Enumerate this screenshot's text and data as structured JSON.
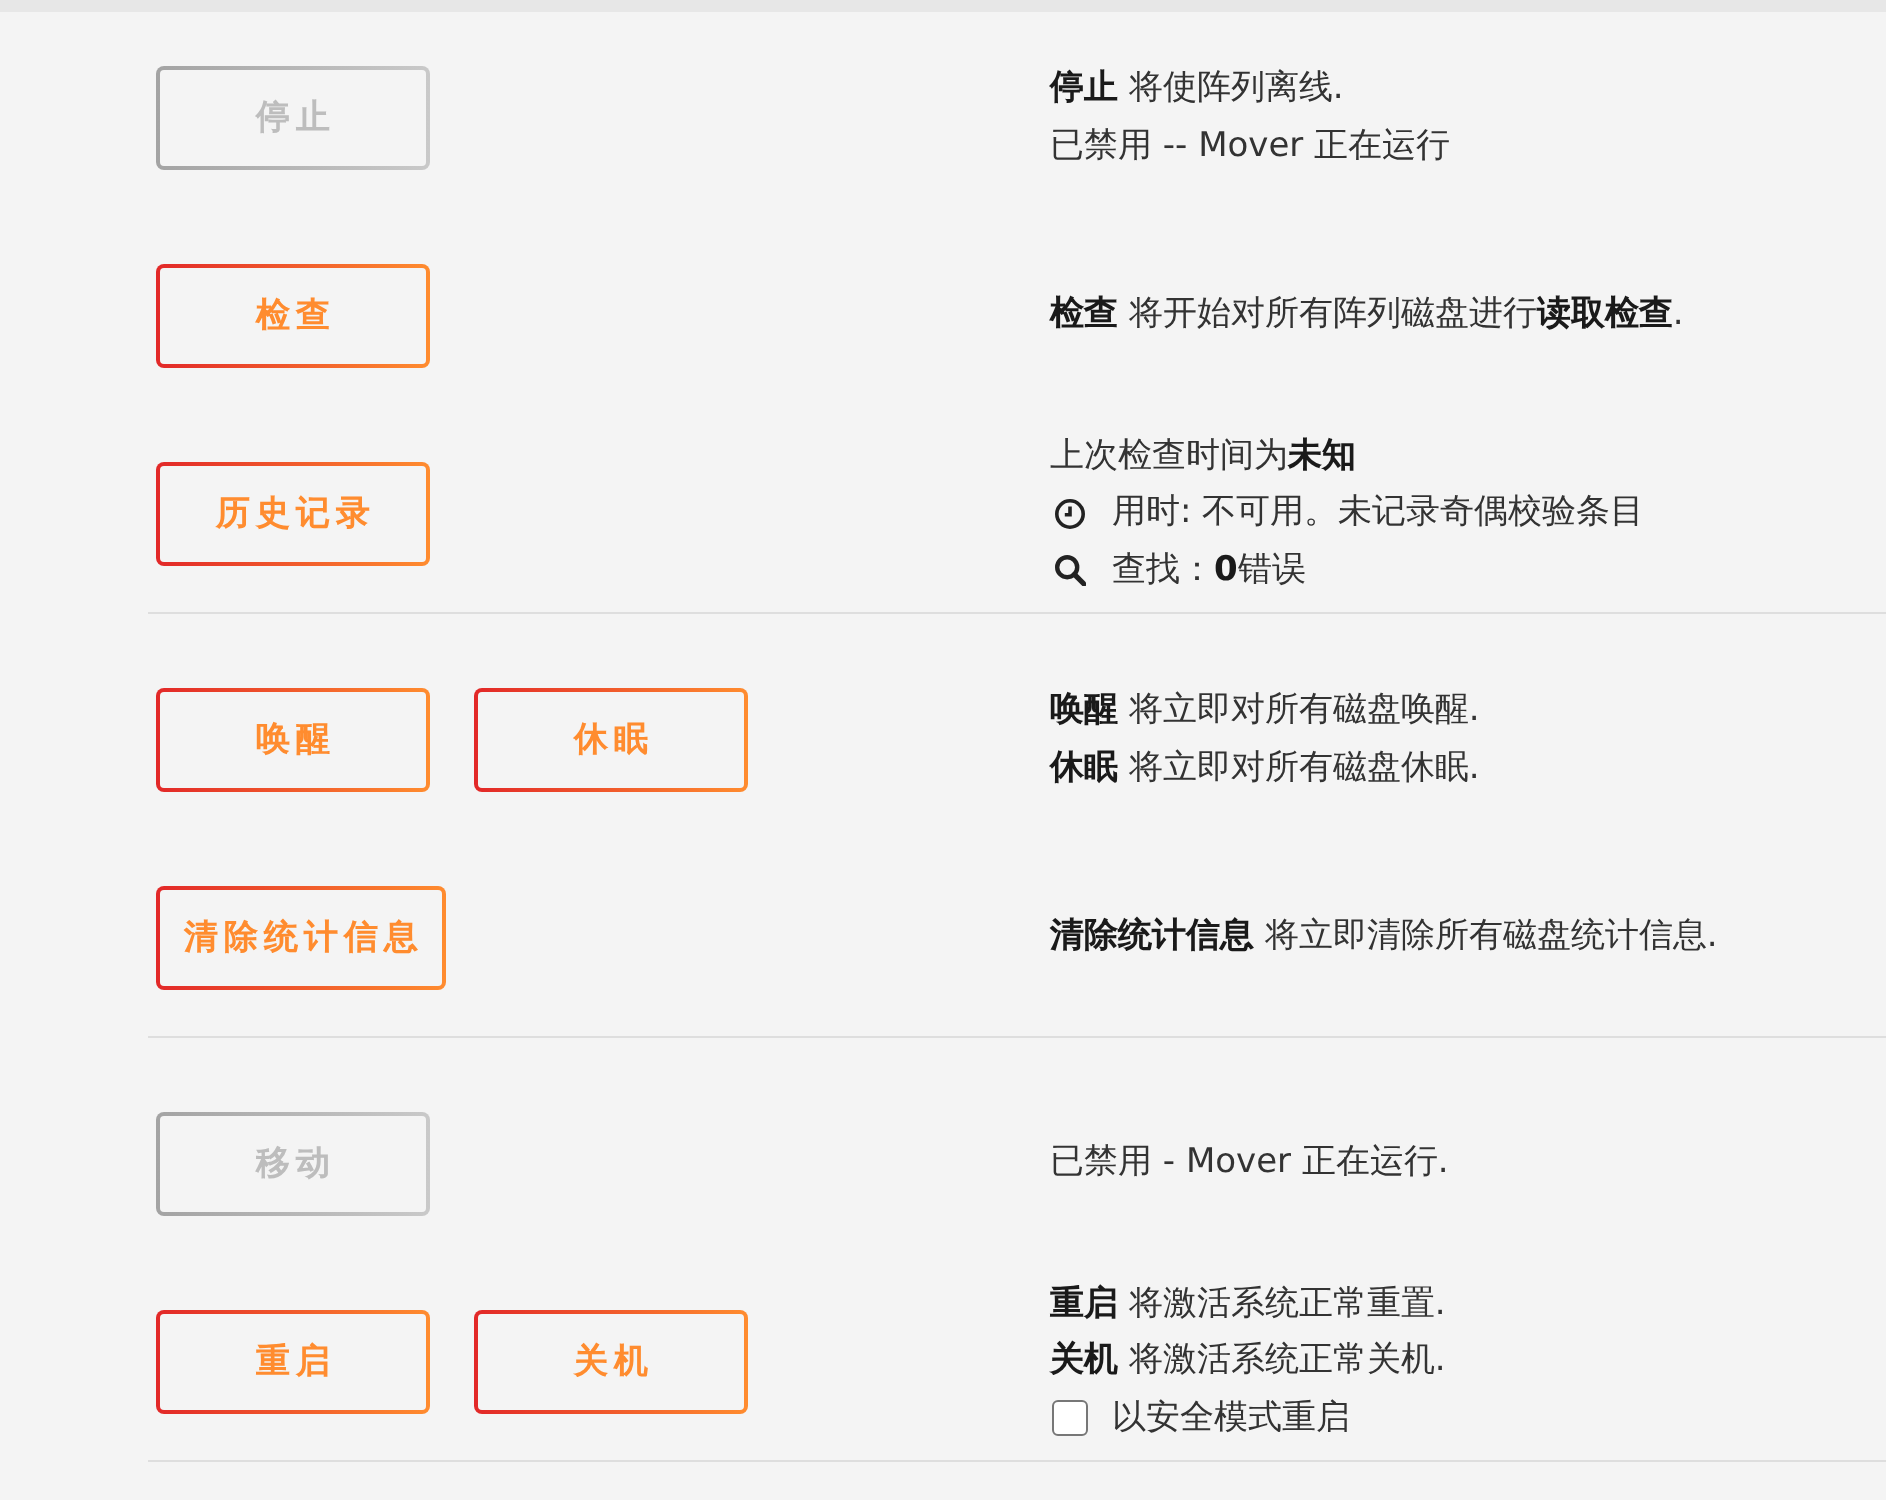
{
  "sections": [
    {
      "rows": [
        {
          "buttons": [
            {
              "label": "停止",
              "disabled": true
            }
          ],
          "lines": [
            {
              "kind": "text",
              "text": "**停止** 将使阵列离线."
            },
            {
              "kind": "text",
              "text": "已禁用 -- Mover 正在运行"
            }
          ]
        },
        {
          "buttons": [
            {
              "label": "检查",
              "disabled": false
            }
          ],
          "lines": [
            {
              "kind": "text",
              "text": "**检查** 将开始对所有阵列磁盘进行**读取检查**."
            }
          ]
        },
        {
          "buttons": [
            {
              "label": "历史记录",
              "disabled": false
            }
          ],
          "lines": [
            {
              "kind": "text",
              "text": "上次检查时间为**未知**"
            },
            {
              "kind": "duration",
              "text": "用时: 不可用。未记录奇偶校验条目"
            },
            {
              "kind": "result",
              "text": "查找：**0**错误"
            }
          ]
        }
      ]
    },
    {
      "rows": [
        {
          "buttons": [
            {
              "label": "唤醒",
              "disabled": false
            },
            {
              "label": "休眠",
              "disabled": false
            }
          ],
          "lines": [
            {
              "kind": "text",
              "text": "**唤醒** 将立即对所有磁盘唤醒."
            },
            {
              "kind": "text",
              "text": "**休眠** 将立即对所有磁盘休眠."
            }
          ]
        },
        {
          "buttons": [
            {
              "label": "清除统计信息",
              "disabled": false
            }
          ],
          "lines": [
            {
              "kind": "text",
              "text": "**清除统计信息** 将立即清除所有磁盘统计信息."
            }
          ]
        }
      ]
    },
    {
      "rows": [
        {
          "buttons": [
            {
              "label": "移动",
              "disabled": true
            }
          ],
          "lines": [
            {
              "kind": "text",
              "text": "已禁用 - Mover 正在运行."
            }
          ]
        },
        {
          "buttons": [
            {
              "label": "重启",
              "disabled": false
            },
            {
              "label": "关机",
              "disabled": false
            }
          ],
          "lines": [
            {
              "kind": "text",
              "text": "**重启** 将激活系统正常重置."
            },
            {
              "kind": "text",
              "text": "**关机** 将激活系统正常关机."
            },
            {
              "kind": "checkbox",
              "text": "以安全模式重启",
              "checked": false
            }
          ]
        }
      ]
    }
  ]
}
